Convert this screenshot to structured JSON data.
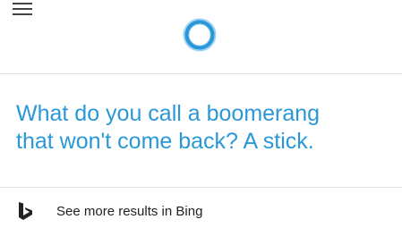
{
  "header": {
    "menu_icon": "hamburger-menu-icon",
    "assistant_icon": "cortana-circle-icon",
    "accent_color": "#2a98d8"
  },
  "answer": {
    "line1": "What do you call a boomerang",
    "line2": "that won't come back? A stick."
  },
  "footer": {
    "bing_icon": "bing-logo-icon",
    "bing_link_label": "See more results in Bing"
  }
}
